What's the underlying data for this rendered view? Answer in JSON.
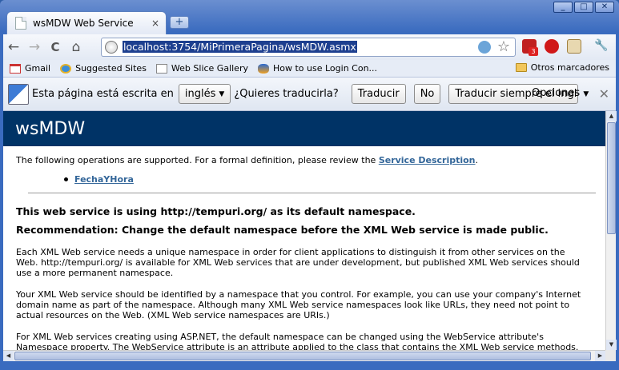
{
  "window": {
    "controls": [
      "_",
      "□",
      "✕"
    ]
  },
  "tab": {
    "title": "wsMDW Web Service",
    "close": "×"
  },
  "newtab": {
    "label": "+"
  },
  "toolbar": {
    "back": "←",
    "forward": "→",
    "reload": "C",
    "home": "⌂",
    "url": "localhost:3754/MiPrimeraPagina/wsMDW.asmx",
    "star": "☆",
    "ext_badge": "3",
    "wrench": "🔧"
  },
  "bookmarks": {
    "items": [
      {
        "label": "Gmail",
        "icon": "gmail-icon"
      },
      {
        "label": "Suggested Sites",
        "icon": "ie-icon"
      },
      {
        "label": "Web Slice Gallery",
        "icon": "page-icon"
      },
      {
        "label": "How to use Login Con...",
        "icon": "flame-icon"
      }
    ],
    "other": "Otros marcadores"
  },
  "translate": {
    "prefix": "Esta página está escrita en",
    "language": "inglés",
    "question": "¿Quieres traducirla?",
    "translate_btn": "Traducir",
    "no_btn": "No",
    "always_btn": "Traducir siempre el inglés",
    "options": "Opciones",
    "close": "✕"
  },
  "page": {
    "banner": "wsMDW",
    "intro": "The following operations are supported. For a formal definition, please review the ",
    "intro_link": "Service Description",
    "intro_end": ".",
    "operation": "FechaYHora",
    "heading1": "This web service is using http://tempuri.org/ as its default namespace.",
    "heading2": "Recommendation: Change the default namespace before the XML Web service is made public.",
    "p1": "Each XML Web service needs a unique namespace in order for client applications to distinguish it from other services on the Web. http://tempuri.org/ is available for XML Web services that are under development, but published XML Web services should use a more permanent namespace.",
    "p2": "Your XML Web service should be identified by a namespace that you control. For example, you can use your company's Internet domain name as part of the namespace. Although many XML Web service namespaces look like URLs, they need not point to actual resources on the Web. (XML Web service namespaces are URIs.)",
    "p3": "For XML Web services creating using ASP.NET, the default namespace can be changed using the WebService attribute's Namespace property. The WebService attribute is an attribute applied to the class that contains the XML Web service methods. Below is a code example that sets the namespace to \"http://microsoft.com/webservices/\":"
  },
  "colors": {
    "banner": "#003366",
    "link": "#336699",
    "frame": "#3a6bbf"
  }
}
